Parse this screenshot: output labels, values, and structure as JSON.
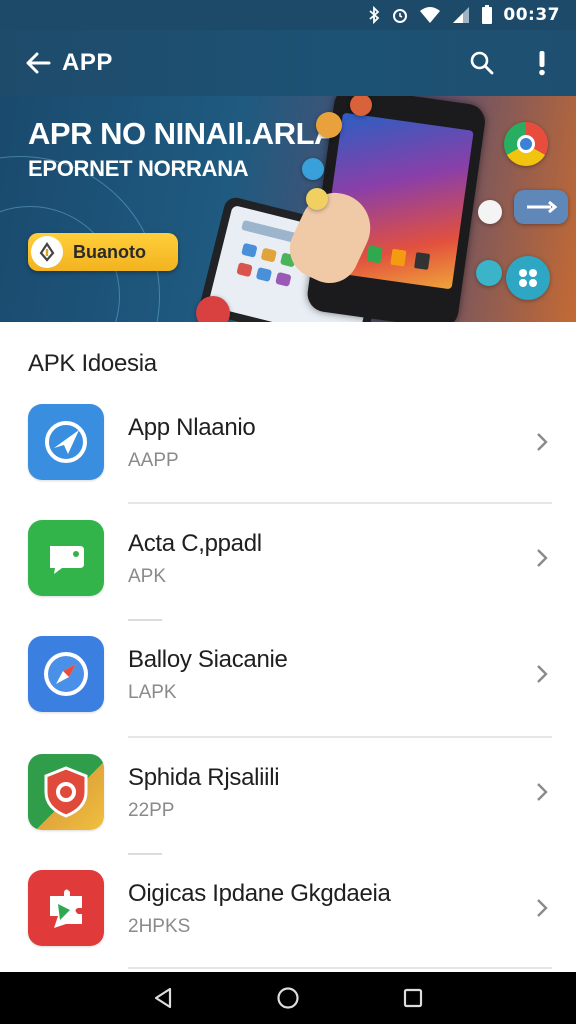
{
  "status_bar": {
    "time": "00:37",
    "icons": [
      "bluetooth-icon",
      "alarm-icon",
      "wifi-icon",
      "signal-icon",
      "battery-icon"
    ]
  },
  "app_bar": {
    "title": "APP",
    "back_icon": "arrow-left-icon",
    "search_icon": "search-icon",
    "more_icon": "exclamation-icon"
  },
  "banner": {
    "headline": "APR NO NINAIl.ARLA",
    "subheadline": "EPORNET NORRANA",
    "button_label": "Buanoto"
  },
  "section": {
    "title": "APK Idoesia"
  },
  "apps": [
    {
      "name": "App Nlaanio",
      "type": "AAPP",
      "icon": "send-icon",
      "color": "#3a8ee0"
    },
    {
      "name": "Acta C,ppadl",
      "type": "APK",
      "icon": "chat-icon",
      "color": "#33b44a"
    },
    {
      "name": "Balloy Siacanie",
      "type": "LAPK",
      "icon": "compass-icon",
      "color": "#3b7fe0"
    },
    {
      "name": "Sphida Rjsaliili",
      "type": "22PP",
      "icon": "shield-icon",
      "color": "#2b9a4a"
    },
    {
      "name": "Oigicas Ipdane Gkgdaeia",
      "type": "2HPKS",
      "icon": "puzzle-icon",
      "color": "#e03a3a"
    }
  ],
  "nav_bar": {
    "back": "triangle-back-icon",
    "home": "circle-home-icon",
    "recents": "square-recents-icon"
  }
}
